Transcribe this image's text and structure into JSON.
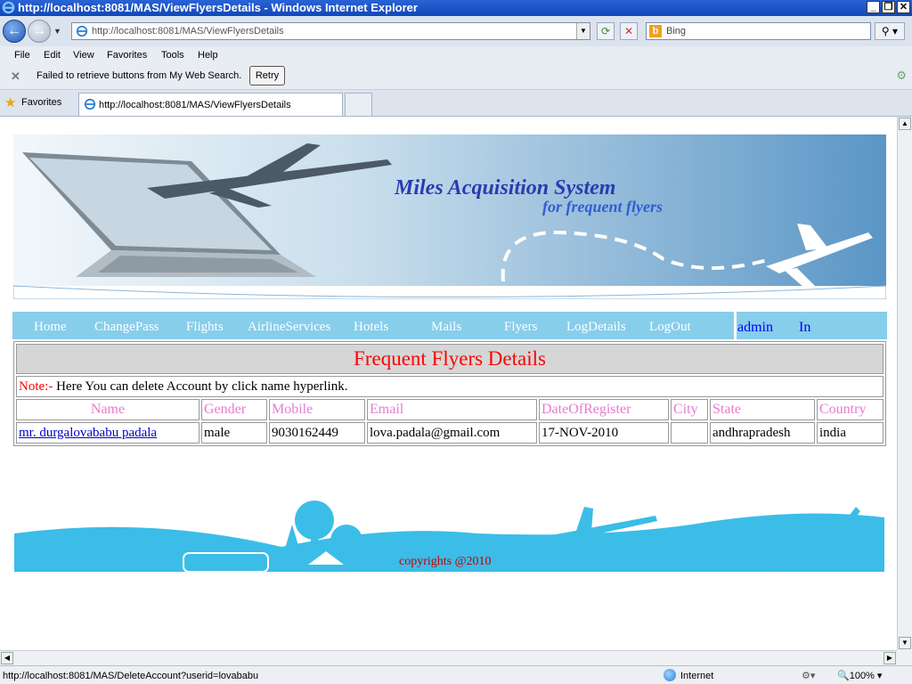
{
  "window": {
    "title": "http://localhost:8081/MAS/ViewFlyersDetails - Windows Internet Explorer"
  },
  "address_bar": {
    "url": "http://localhost:8081/MAS/ViewFlyersDetails"
  },
  "search_box": {
    "placeholder": "Bing"
  },
  "menu_bar": [
    "File",
    "Edit",
    "View",
    "Favorites",
    "Tools",
    "Help"
  ],
  "info_bar": {
    "message": "Failed to retrieve buttons from My Web Search.",
    "retry_label": "Retry"
  },
  "favorites_bar": {
    "label": "Favorites",
    "tab_title": "http://localhost:8081/MAS/ViewFlyersDetails"
  },
  "banner": {
    "title": "Miles Acquisition System",
    "subtitle": "for frequent flyers"
  },
  "site_menu": {
    "items": [
      "Home",
      "ChangePass",
      "Flights",
      "AirlineServices",
      "Hotels",
      "Mails",
      "Flyers",
      "LogDetails",
      "LogOut"
    ],
    "user": "admin",
    "state": "In"
  },
  "content": {
    "heading": "Frequent Flyers Details",
    "note_label": "Note:-",
    "note_text": " Here You can delete Account by click name hyperlink.",
    "columns": [
      "Name",
      "Gender",
      "Mobile",
      "Email",
      "DateOfRegister",
      "City",
      "State",
      "Country"
    ],
    "rows": [
      {
        "name": "mr. durgalovababu padala",
        "gender": "male",
        "mobile": "9030162449",
        "email": "lova.padala@gmail.com",
        "date": "17-NOV-2010",
        "city": "",
        "state": "andhrapradesh",
        "country": "india"
      }
    ]
  },
  "footer": {
    "copyright": "copyrights @2010"
  },
  "status_bar": {
    "url": "http://localhost:8081/MAS/DeleteAccount?userid=lovababu",
    "zone": "Internet",
    "zoom": "100%"
  },
  "colors": {
    "menu_bg": "#87ceeb",
    "heading": "#ff0000",
    "column_header": "#e87ad0",
    "banner_text": "#2a3bb0",
    "footer_scene": "#3bbde8"
  }
}
